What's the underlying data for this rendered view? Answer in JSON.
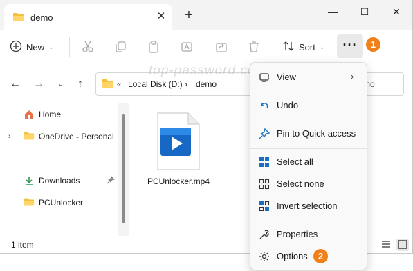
{
  "window": {
    "tab_title": "demo",
    "new_tab_symbol": "+",
    "close_tab_symbol": "✕",
    "minimize_symbol": "—",
    "maximize_symbol": "☐",
    "close_symbol": "✕"
  },
  "toolbar": {
    "new_label": "New",
    "sort_label": "Sort",
    "more_label": "···",
    "more_badge": "1"
  },
  "address": {
    "overflow": "«",
    "drive": "Local Disk (D:)",
    "separator": "›",
    "folder": "demo",
    "search_placeholder": "mo"
  },
  "watermark": "top-password.com",
  "sidebar": {
    "items": [
      {
        "label": "Home",
        "icon": "home-icon"
      },
      {
        "label": "OneDrive - Personal",
        "icon": "folder-icon"
      },
      {
        "label": "Downloads",
        "icon": "download-icon"
      },
      {
        "label": "PCUnlocker",
        "icon": "folder-icon"
      }
    ]
  },
  "files": [
    {
      "name": "PCUnlocker.mp4",
      "icon": "video-file-icon"
    }
  ],
  "status": {
    "count": "1 item"
  },
  "menu": {
    "items": [
      {
        "label": "View",
        "icon": "view-icon",
        "has_submenu": true
      },
      {
        "label": "Undo",
        "icon": "undo-icon"
      },
      {
        "label": "Pin to Quick access",
        "icon": "pin-icon"
      },
      {
        "label": "Select all",
        "icon": "select-all-icon"
      },
      {
        "label": "Select none",
        "icon": "select-none-icon"
      },
      {
        "label": "Invert selection",
        "icon": "invert-selection-icon"
      },
      {
        "label": "Properties",
        "icon": "properties-icon"
      },
      {
        "label": "Options",
        "icon": "gear-icon"
      }
    ],
    "options_badge": "2"
  },
  "colors": {
    "accent": "#0067c0",
    "folder": "#f5c13c",
    "badge": "#f0801a"
  }
}
